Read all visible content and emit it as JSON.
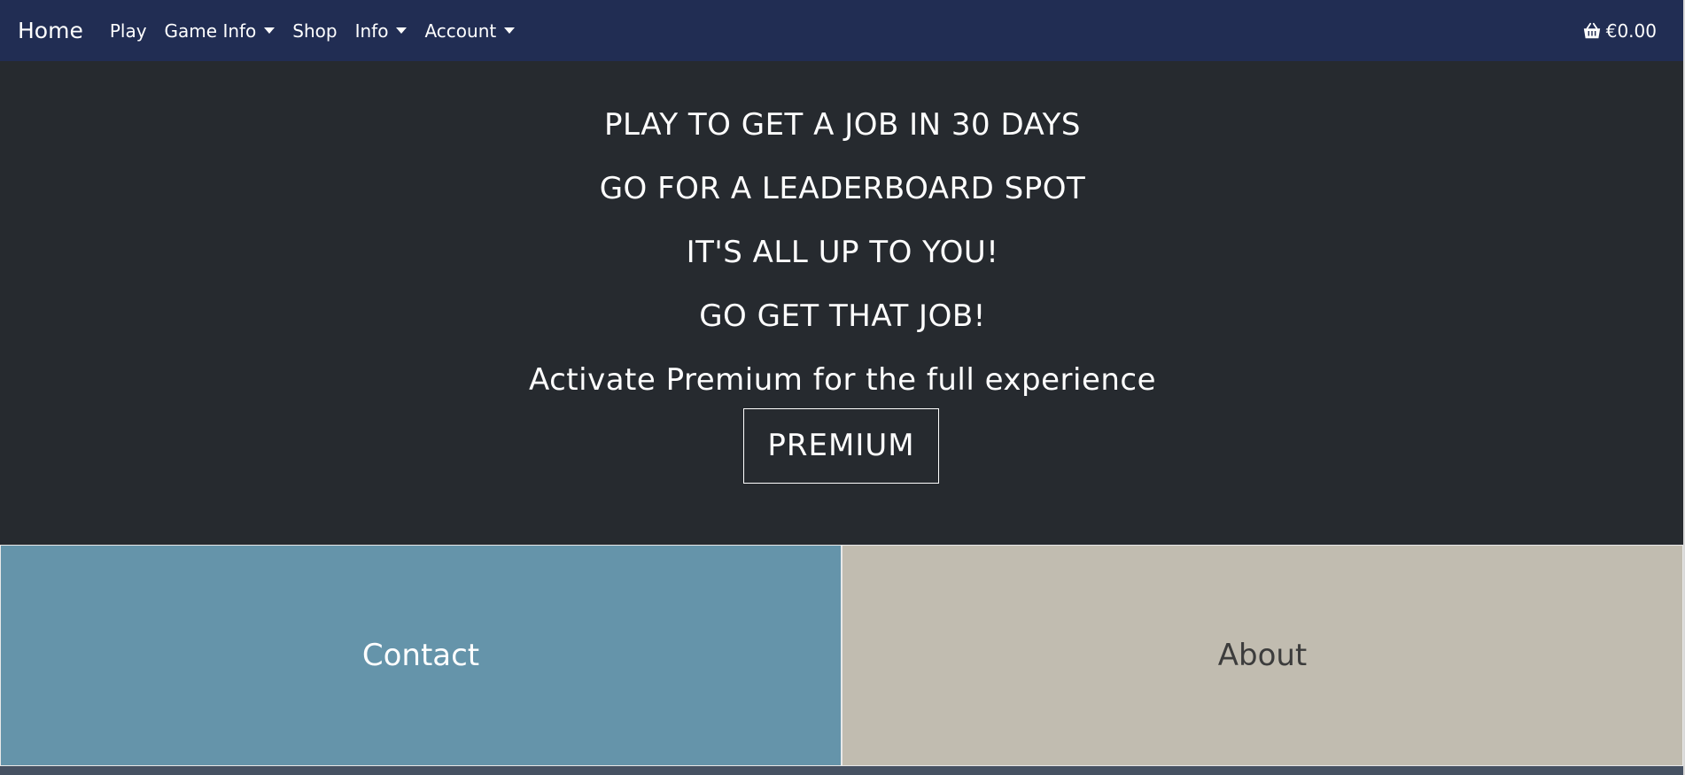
{
  "nav": {
    "brand": "Home",
    "items": [
      {
        "label": "Play",
        "dropdown": false
      },
      {
        "label": "Game Info",
        "dropdown": true
      },
      {
        "label": "Shop",
        "dropdown": false
      },
      {
        "label": "Info",
        "dropdown": true
      },
      {
        "label": "Account",
        "dropdown": true
      }
    ],
    "cart": {
      "icon": "basket-icon",
      "total": "€0.00"
    }
  },
  "hero": {
    "lines": [
      "PLAY TO GET A JOB IN 30 DAYS",
      "GO FOR A LEADERBOARD SPOT",
      "IT'S ALL UP TO YOU!",
      "GO GET THAT JOB!",
      "Activate Premium for the full experience"
    ],
    "button": "PREMIUM"
  },
  "tiles": {
    "contact": "Contact",
    "about": "About"
  },
  "colors": {
    "navbar": "#212d53",
    "hero_bg": "#262a2f",
    "contact_bg": "#6594aa",
    "about_bg": "#c1bcb0"
  }
}
